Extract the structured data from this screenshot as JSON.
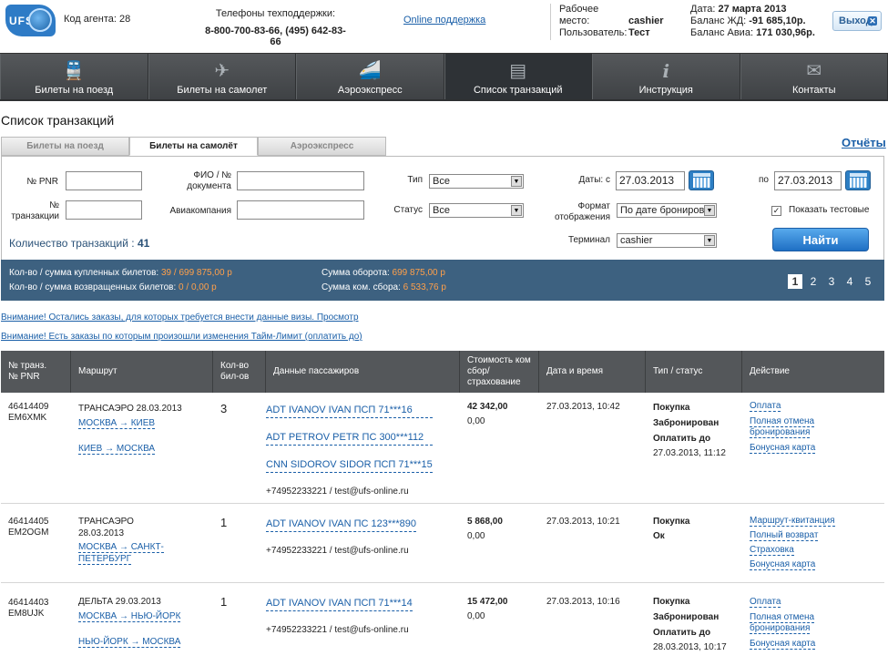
{
  "header": {
    "logo_text": "UFS",
    "agent_code_label": "Код агента:",
    "agent_code": "28",
    "support_label": "Телефоны техподдержки:",
    "support_phones": "8-800-700-83-66, (495) 642-83-66",
    "online_support": "Online поддержка",
    "workplace_label": "Рабочее место:",
    "workplace": "cashier",
    "user_label": "Пользователь:",
    "user": "Тест",
    "date_label": "Дата:",
    "date": "27 марта 2013",
    "balance_rail_label": "Баланс ЖД:",
    "balance_rail": "-91 685,10р.",
    "balance_avia_label": "Баланс Авиа:",
    "balance_avia": "171 030,96р.",
    "exit_label": "Выход"
  },
  "nav": [
    {
      "label": "Билеты на поезд",
      "icon": "train-icon"
    },
    {
      "label": "Билеты на самолет",
      "icon": "plane-icon"
    },
    {
      "label": "Аэроэкспресс",
      "icon": "aeroexpress-icon"
    },
    {
      "label": "Список транзакций",
      "icon": "list-icon"
    },
    {
      "label": "Инструкция",
      "icon": "info-icon"
    },
    {
      "label": "Контакты",
      "icon": "mail-icon"
    }
  ],
  "page_title": "Список транзакций",
  "tabs": [
    "Билеты на поезд",
    "Билеты на самолёт",
    "Аэроэкспресс"
  ],
  "reports_link": "Отчёты",
  "filter": {
    "pnr_label": "№ PNR",
    "txn_label": "№ транзакции",
    "fio_label": "ФИО / № документа",
    "airline_label": "Авиакомпания",
    "type_label": "Тип",
    "type_value": "Все",
    "status_label": "Статус",
    "status_value": "Все",
    "dates_from_label": "Даты: с",
    "date_from": "27.03.2013",
    "dates_to_label": "по",
    "date_to": "27.03.2013",
    "format_label": "Формат отображения",
    "format_value": "По дате брониров",
    "terminal_label": "Терминал",
    "terminal_value": "cashier",
    "show_test_label": "Показать тестовые",
    "find_label": "Найти",
    "count_label": "Количество транзакций :",
    "count": "41"
  },
  "stats": {
    "bought_label": "Кол-во / сумма купленных билетов:",
    "bought": "39 / 699 875,00 р",
    "returned_label": "Кол-во / сумма возвращенных билетов:",
    "returned": "0 / 0,00 р",
    "turnover_label": "Сумма оборота:",
    "turnover": "699 875,00 р",
    "fee_label": "Сумма ком. сбора:",
    "fee": "6 533,76 р",
    "pages": [
      "1",
      "2",
      "3",
      "4",
      "5"
    ]
  },
  "warnings": [
    "Внимание! Остались заказы, для которых требуется внести данные визы. Просмотр",
    "Внимание! Есть заказы по которым произошли изменения Тайм-Лимит (оплатить до)"
  ],
  "table": {
    "headers": [
      "№ транз.\n№ PNR",
      "Маршрут",
      "Кол-во бил-ов",
      "Данные пассажиров",
      "Стоимость ком сбор/ страхование",
      "Дата и время",
      "Тип / статус",
      "Действие"
    ],
    "rows": [
      {
        "txn": "46414409",
        "pnr": "EM6XMK",
        "carrier": "ТРАНСАЭРО 28.03.2013",
        "route1": "МОСКВА → КИЕВ",
        "route2": "КИЕВ → МОСКВА",
        "count": "3",
        "pax": [
          "ADT IVANOV IVAN ПСП 71***16",
          "ADT PETROV PETR ПС 300***112",
          "CNN SIDOROV SIDOR ПСП 71***15"
        ],
        "contact": "+74952233221 / test@ufs-online.ru",
        "cost": "42 342,00",
        "fee": "0,00",
        "datetime": "27.03.2013, 10:42",
        "type": "Покупка",
        "status": "Забронирован",
        "pay_until_label": "Оплатить до",
        "pay_until": "27.03.2013, 11:12",
        "actions": [
          "Оплата",
          "Полная отмена бронирования",
          "Бонусная карта"
        ]
      },
      {
        "txn": "46414405",
        "pnr": "EM2OGM",
        "carrier": "ТРАНСАЭРО 28.03.2013",
        "route1": "МОСКВА → САНКТ-ПЕТЕРБУРГ",
        "route2": "",
        "count": "1",
        "pax": [
          "ADT IVANOV IVAN ПС 123***890"
        ],
        "contact": "+74952233221 / test@ufs-online.ru",
        "cost": "5 868,00",
        "fee": "0,00",
        "datetime": "27.03.2013, 10:21",
        "type": "Покупка",
        "status": "Ок",
        "pay_until_label": "",
        "pay_until": "",
        "actions": [
          "Маршрут-квитанция",
          "Полный возврат",
          "Страховка",
          "Бонусная карта"
        ]
      },
      {
        "txn": "46414403",
        "pnr": "EM8UJK",
        "carrier": "ДЕЛЬТА 29.03.2013",
        "route1": "МОСКВА → НЬЮ-ЙОРК",
        "route2": "НЬЮ-ЙОРК → МОСКВА",
        "count": "1",
        "pax": [
          "ADT IVANOV IVAN ПСП 71***14"
        ],
        "contact": "+74952233221 / test@ufs-online.ru",
        "cost": "15 472,00",
        "fee": "0,00",
        "datetime": "27.03.2013, 10:16",
        "type": "Покупка",
        "status": "Забронирован",
        "pay_until_label": "Оплатить до",
        "pay_until": "28.03.2013, 10:17",
        "actions": [
          "Оплата",
          "Полная отмена бронирования",
          "Бонусная карта"
        ]
      }
    ]
  }
}
